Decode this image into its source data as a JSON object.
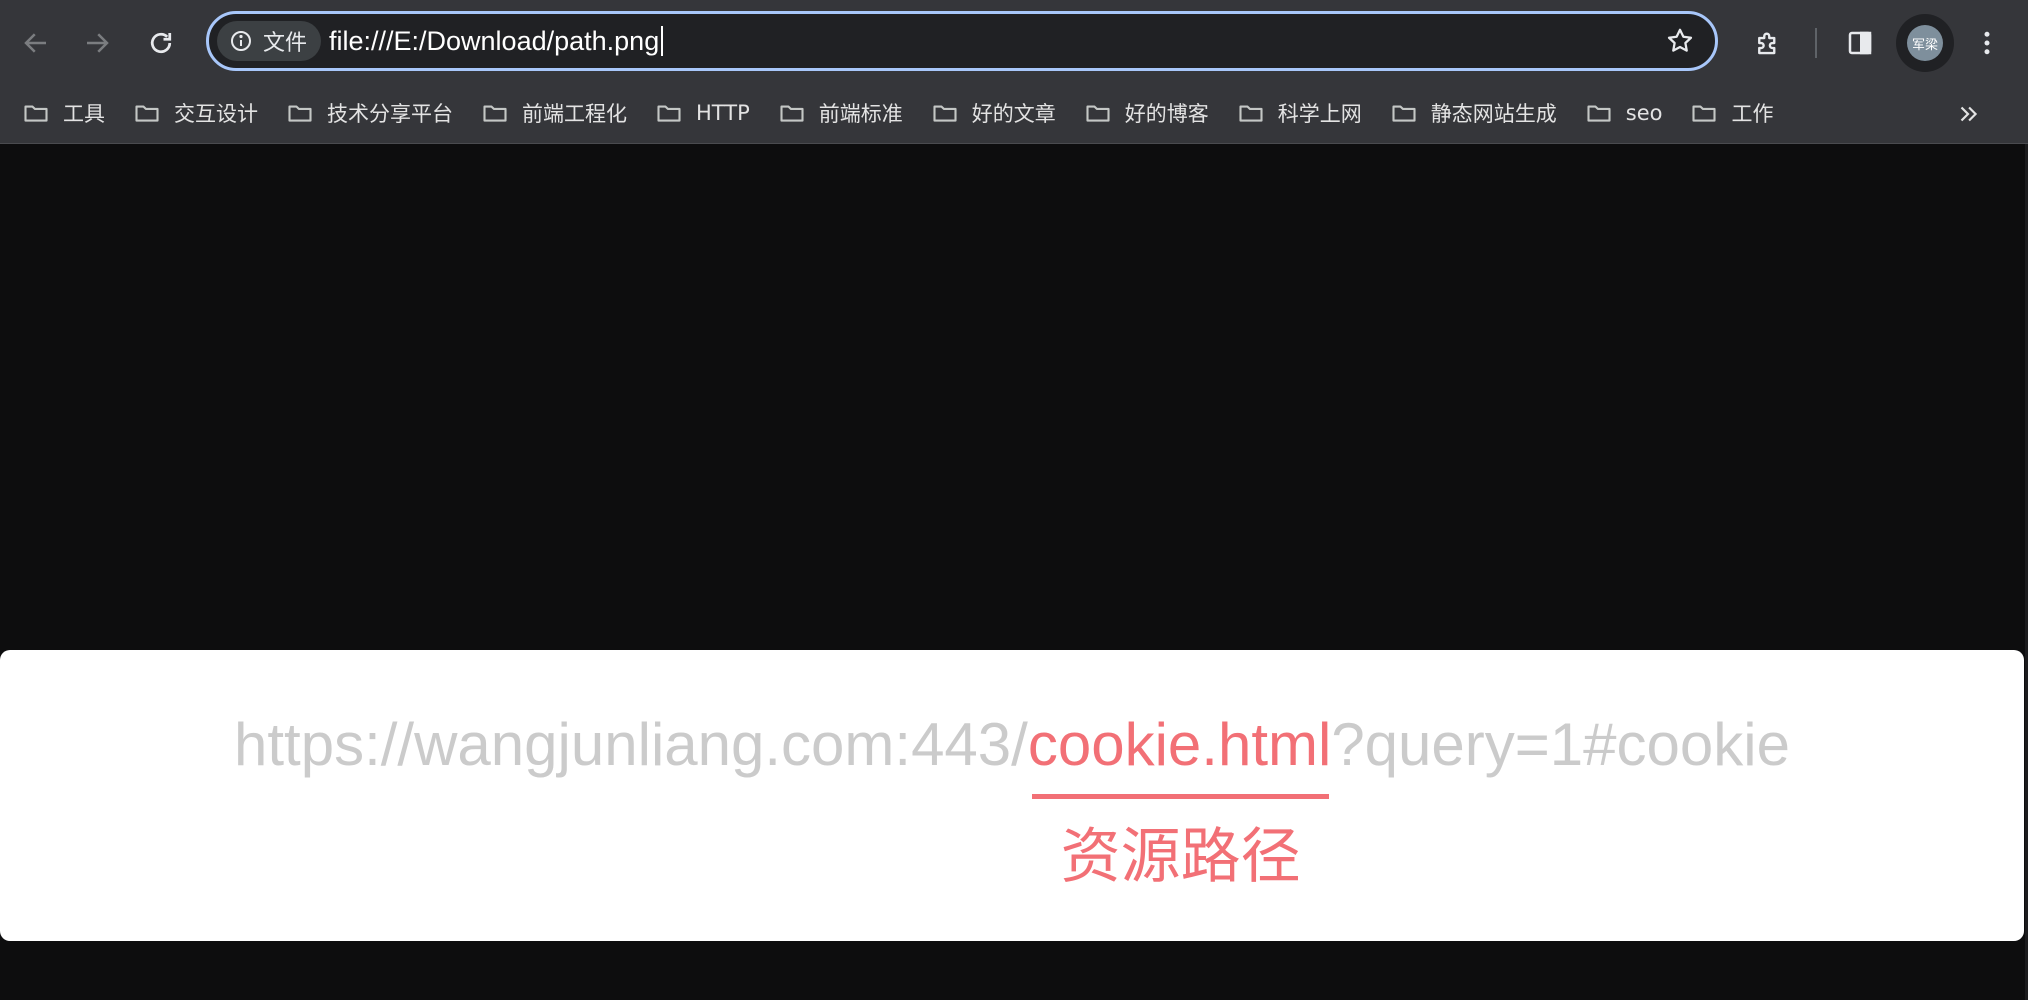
{
  "toolbar": {
    "back_icon": "arrow-left-icon",
    "forward_icon": "arrow-right-icon",
    "reload_icon": "reload-icon",
    "site_info_label": "文件",
    "url": "file:///E:/Download/path.png",
    "bookmark_icon": "star-icon",
    "extensions_icon": "puzzle-icon",
    "side_panel_icon": "side-panel-icon",
    "profile_label": "军梁",
    "menu_icon": "kebab-menu-icon"
  },
  "bookmarks": {
    "items": [
      {
        "label": "工具"
      },
      {
        "label": "交互设计"
      },
      {
        "label": "技术分享平台"
      },
      {
        "label": "前端工程化"
      },
      {
        "label": "HTTP"
      },
      {
        "label": "前端标准"
      },
      {
        "label": "好的文章"
      },
      {
        "label": "好的博客"
      },
      {
        "label": "科学上网"
      },
      {
        "label": "静态网站生成"
      },
      {
        "label": "seo"
      },
      {
        "label": "工作"
      }
    ],
    "more_icon": "chevron-double-right-icon"
  },
  "image": {
    "url_prefix": "https://wangjunliang.com:443/",
    "url_highlight": "cookie.html",
    "url_suffix": "?query=1#cookie",
    "annotation": "资源路径",
    "highlight_color": "#f27076",
    "muted_color": "#cbcbcb"
  }
}
